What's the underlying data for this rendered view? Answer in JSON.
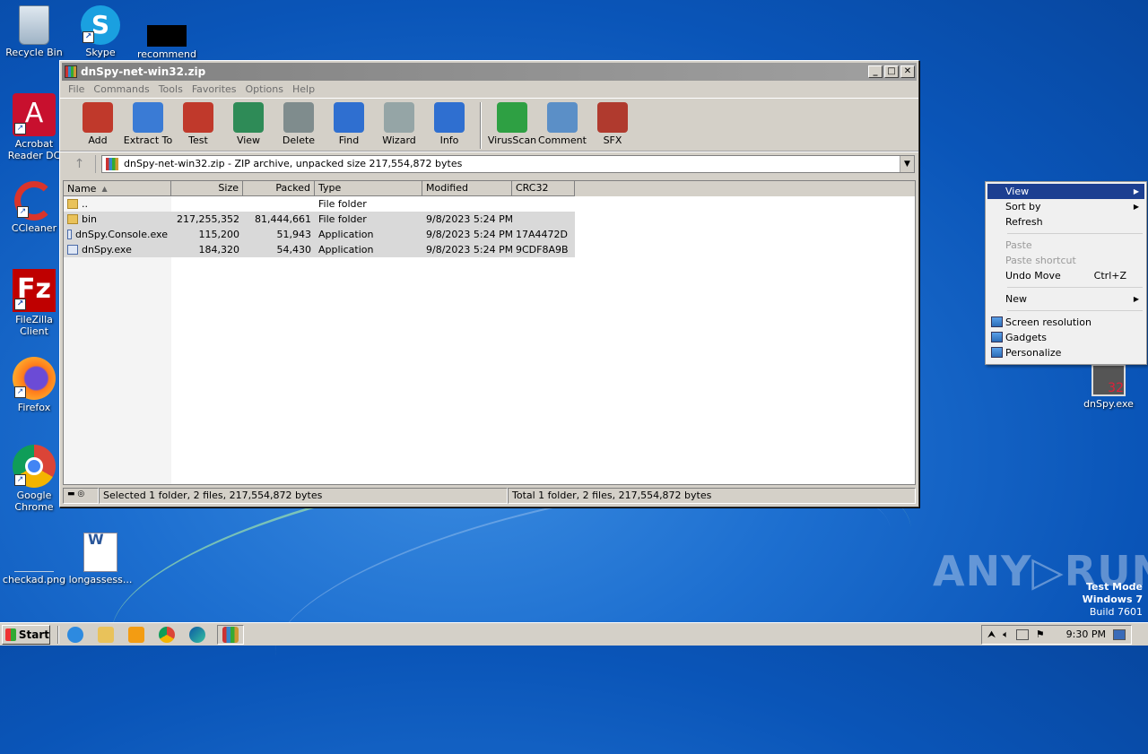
{
  "desktop": {
    "icons_left": [
      {
        "label": "Recycle Bin"
      },
      {
        "label": "Skype"
      },
      {
        "label": "recommend"
      },
      {
        "label": "Acrobat Reader DC"
      },
      {
        "label": "CCleaner"
      },
      {
        "label": "FileZilla Client"
      },
      {
        "label": "Firefox"
      },
      {
        "label": "Google Chrome"
      },
      {
        "label": "checkad.png"
      },
      {
        "label": "longassess..."
      }
    ],
    "icon_right": {
      "label": "dnSpy.exe"
    }
  },
  "window": {
    "title": "dnSpy-net-win32.zip",
    "buttons": {
      "minimize": "_",
      "maximize": "□",
      "close": "✕"
    },
    "menu": [
      "File",
      "Commands",
      "Tools",
      "Favorites",
      "Options",
      "Help"
    ],
    "toolbar": [
      {
        "label": "Add",
        "icon": "add-icon",
        "color": "#c0392b"
      },
      {
        "label": "Extract To",
        "icon": "extract-folder-icon",
        "color": "#3a7bd5"
      },
      {
        "label": "Test",
        "icon": "test-clipboard-icon",
        "color": "#c0392b"
      },
      {
        "label": "View",
        "icon": "view-book-icon",
        "color": "#2e8b57"
      },
      {
        "label": "Delete",
        "icon": "trash-icon",
        "color": "#7f8c8d"
      },
      {
        "label": "Find",
        "icon": "magnifier-icon",
        "color": "#2f6fd0"
      },
      {
        "label": "Wizard",
        "icon": "wand-icon",
        "color": "#95a5a6"
      },
      {
        "label": "Info",
        "icon": "info-icon",
        "color": "#2f6fd0"
      },
      {
        "label": "VirusScan",
        "icon": "virus-icon",
        "color": "#2ea043"
      },
      {
        "label": "Comment",
        "icon": "comment-icon",
        "color": "#5b8fc7"
      },
      {
        "label": "SFX",
        "icon": "sfx-books-icon",
        "color": "#b03a2e"
      }
    ],
    "address": "dnSpy-net-win32.zip - ZIP archive, unpacked size 217,554,872 bytes",
    "columns": [
      "Name",
      "Size",
      "Packed",
      "Type",
      "Modified",
      "CRC32"
    ],
    "rows": [
      {
        "name": "..",
        "size": "",
        "packed": "",
        "type": "File folder",
        "modified": "",
        "crc": "",
        "kind": "folder",
        "selected": false
      },
      {
        "name": "bin",
        "size": "217,255,352",
        "packed": "81,444,661",
        "type": "File folder",
        "modified": "9/8/2023 5:24 PM",
        "crc": "",
        "kind": "folder",
        "selected": true
      },
      {
        "name": "dnSpy.Console.exe",
        "size": "115,200",
        "packed": "51,943",
        "type": "Application",
        "modified": "9/8/2023 5:24 PM",
        "crc": "17A4472D",
        "kind": "app",
        "selected": true
      },
      {
        "name": "dnSpy.exe",
        "size": "184,320",
        "packed": "54,430",
        "type": "Application",
        "modified": "9/8/2023 5:24 PM",
        "crc": "9CDF8A9B",
        "kind": "app",
        "selected": true
      }
    ],
    "status_left": "Selected 1 folder, 2 files, 217,554,872 bytes",
    "status_right": "Total 1 folder, 2 files, 217,554,872 bytes"
  },
  "context_menu": {
    "items": [
      {
        "label": "View",
        "submenu": true,
        "highlighted": true
      },
      {
        "label": "Sort by",
        "submenu": true
      },
      {
        "label": "Refresh"
      },
      {
        "sep": true
      },
      {
        "label": "Paste",
        "disabled": true
      },
      {
        "label": "Paste shortcut",
        "disabled": true
      },
      {
        "label": "Undo Move",
        "shortcut": "Ctrl+Z"
      },
      {
        "sep": true
      },
      {
        "label": "New",
        "submenu": true
      },
      {
        "sep": true
      },
      {
        "label": "Screen resolution",
        "icon": "screen-resolution-icon"
      },
      {
        "label": "Gadgets",
        "icon": "gadgets-icon"
      },
      {
        "label": "Personalize",
        "icon": "personalize-icon"
      }
    ]
  },
  "taskbar": {
    "start": "Start",
    "clock": "9:30 PM"
  },
  "watermark": {
    "line1": "Test Mode",
    "line2": "Windows 7",
    "line3": "Build 7601",
    "brand": "ANY▷RUN"
  }
}
